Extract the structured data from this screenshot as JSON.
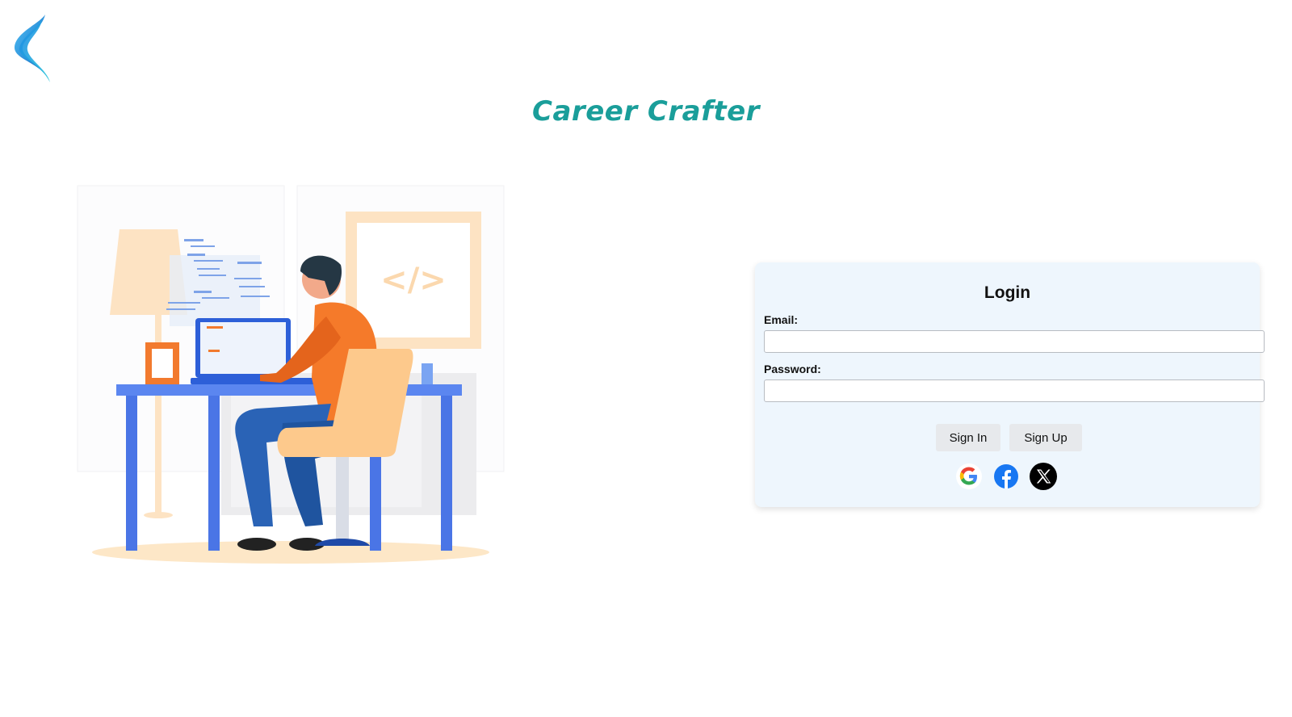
{
  "header": {
    "app_title": "Career Crafter",
    "logo_icon": "career-crafter-logo-icon"
  },
  "illustration": {
    "subject": "developer-at-desk-illustration",
    "code_sign": "</>"
  },
  "login": {
    "title": "Login",
    "email_label": "Email:",
    "email_value": "",
    "password_label": "Password:",
    "password_value": "",
    "sign_in_label": "Sign In",
    "sign_up_label": "Sign Up",
    "social_icons": [
      "google-icon",
      "facebook-icon",
      "x-icon"
    ]
  },
  "colors": {
    "title_teal": "#1a9e9a",
    "card_background": "#eef6fd",
    "button_background": "#e7e9ec",
    "facebook_blue": "#1877f2"
  }
}
